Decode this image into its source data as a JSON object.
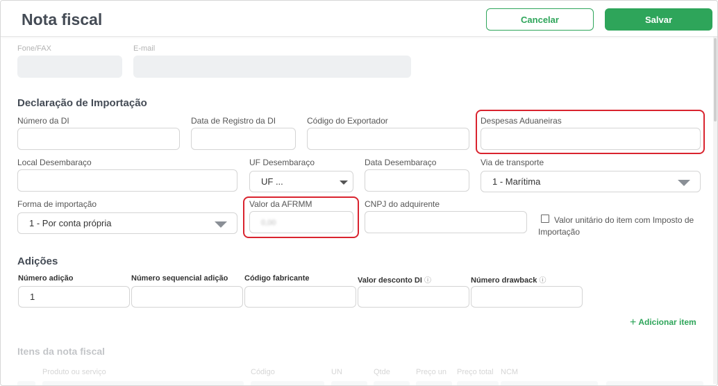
{
  "header": {
    "title": "Nota fiscal",
    "cancel_label": "Cancelar",
    "save_label": "Salvar"
  },
  "contact": {
    "fone_label": "Fone/FAX",
    "email_label": "E-mail"
  },
  "import_declaration": {
    "section_title": "Declaração de Importação",
    "numero_di_label": "Número da DI",
    "data_registro_label": "Data de Registro da DI",
    "codigo_exportador_label": "Código do Exportador",
    "despesas_label": "Despesas Aduaneiras",
    "local_desembaraco_label": "Local Desembaraço",
    "uf_desembaraco_label": "UF Desembaraço",
    "uf_desembaraco_value": "UF ...",
    "data_desembaraco_label": "Data Desembaraço",
    "via_transporte_label": "Via de transporte",
    "via_transporte_value": "1 - Marítima",
    "forma_importacao_label": "Forma de importação",
    "forma_importacao_value": "1 - Por conta própria",
    "valor_afrmm_label": "Valor da AFRMM",
    "valor_afrmm_value": "0,00",
    "cnpj_label": "CNPJ do adquirente",
    "checkbox_label": "Valor unitário do item com Imposto de Importação"
  },
  "additions": {
    "section_title": "Adições",
    "numero_adicao_label": "Número adição",
    "numero_adicao_value": "1",
    "numero_sequencial_label": "Número sequencial adição",
    "codigo_fabricante_label": "Código fabricante",
    "valor_desconto_label": "Valor desconto DI",
    "numero_drawback_label": "Número drawback",
    "info_symbol": "ⓘ",
    "add_item_plus": "+",
    "add_item_label": "Adicionar item"
  },
  "items": {
    "section_title": "Itens da nota fiscal",
    "columns": [
      "Produto ou serviço",
      "Código",
      "UN",
      "Qtde",
      "Preço un",
      "Preço total",
      "NCM"
    ]
  },
  "colors": {
    "accent": "#2ea55a",
    "highlight": "#d9232e",
    "title": "#444b55"
  }
}
